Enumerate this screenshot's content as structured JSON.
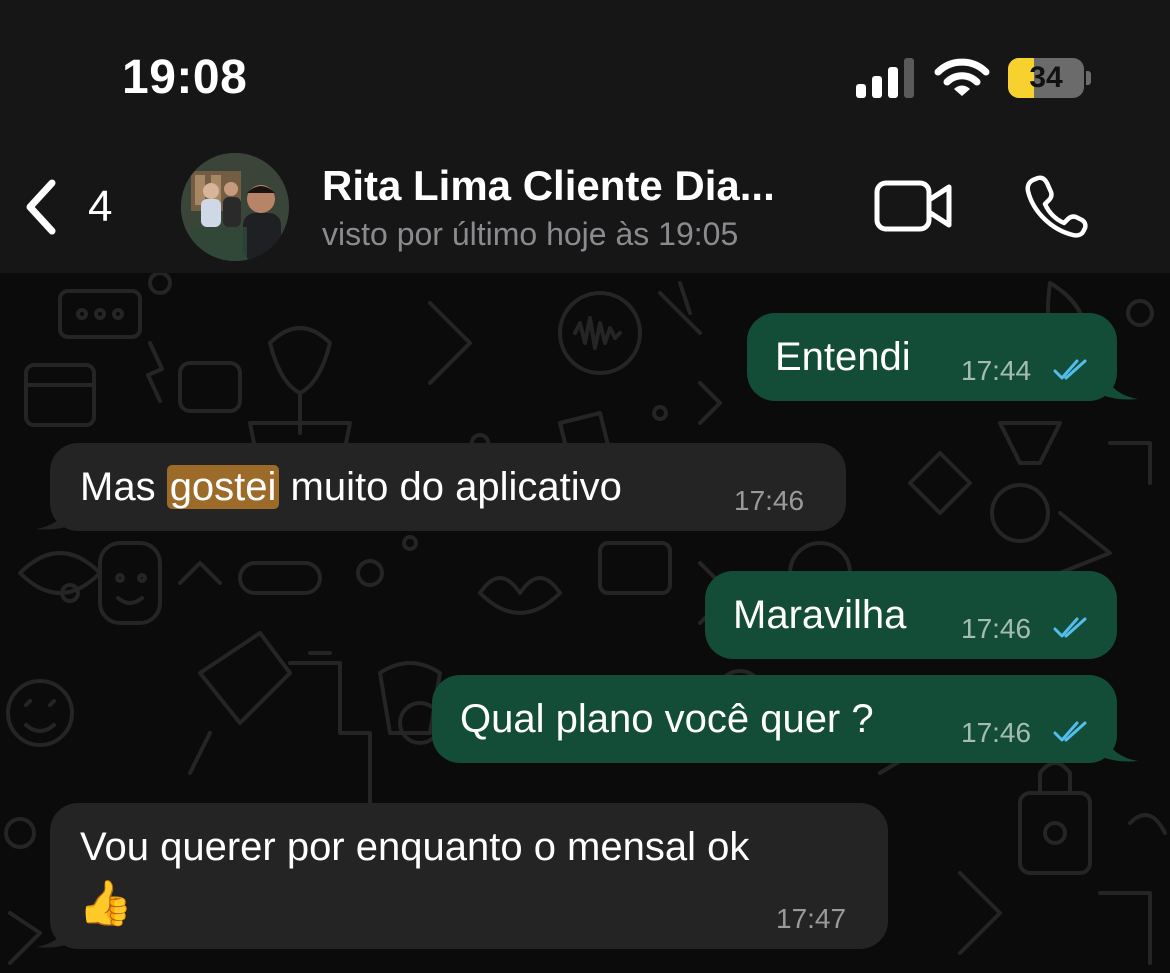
{
  "status_bar": {
    "time": "19:08",
    "battery_level": "34",
    "battery_color": "#f7d12e"
  },
  "header": {
    "back_count": "4",
    "contact_name": "Rita Lima Cliente Dia...",
    "last_seen": "visto por último hoje às 19:05"
  },
  "messages": [
    {
      "direction": "outgoing",
      "text": "Entendi",
      "time": "17:44",
      "status": "read"
    },
    {
      "direction": "incoming",
      "text_before": "Mas ",
      "text_highlight": "gostei",
      "text_after": " muito do aplicativo",
      "time": "17:46"
    },
    {
      "direction": "outgoing",
      "text": "Maravilha",
      "time": "17:46",
      "status": "read"
    },
    {
      "direction": "outgoing",
      "text": "Qual plano você quer ?",
      "time": "17:46",
      "status": "read"
    },
    {
      "direction": "incoming",
      "text": "Vou querer por enquanto o mensal ok",
      "emoji": "👍",
      "time": "17:47"
    }
  ],
  "colors": {
    "outgoing_bubble": "#134d37",
    "incoming_bubble": "#242424",
    "read_receipt": "#53bdeb",
    "search_highlight": "#9c6b29"
  }
}
